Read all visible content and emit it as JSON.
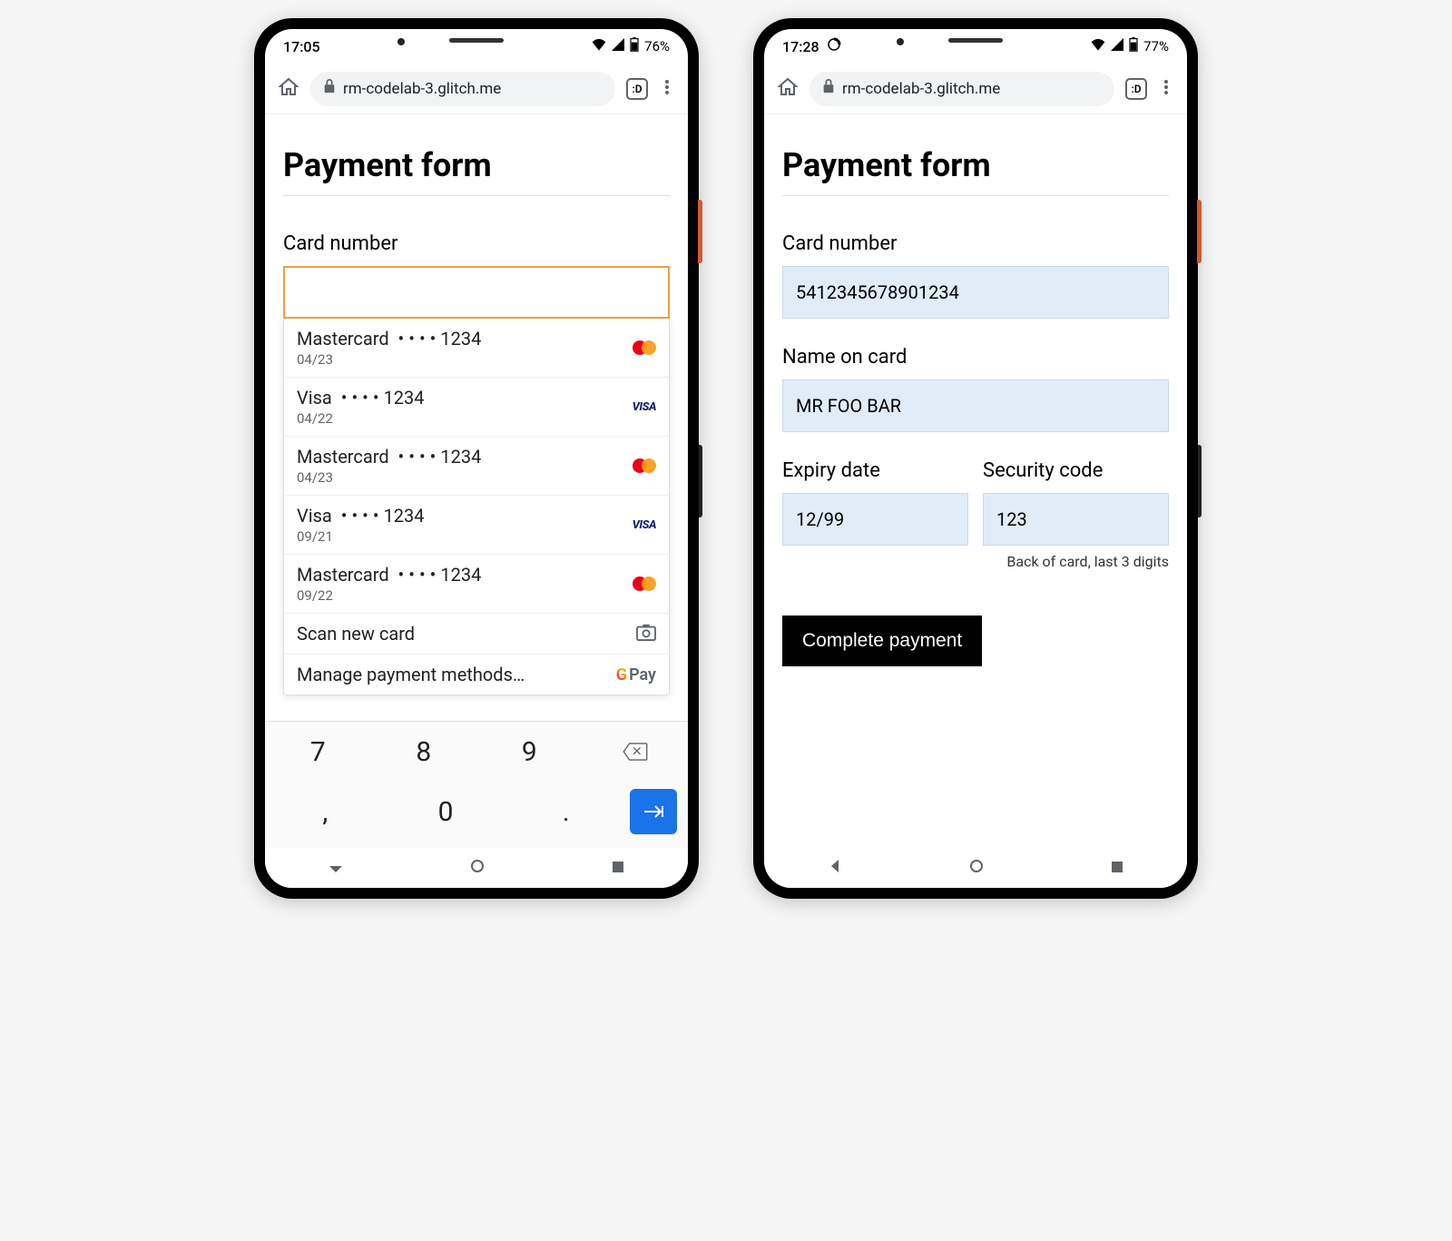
{
  "phone1": {
    "status": {
      "time": "17:05",
      "battery": "76%"
    },
    "browser": {
      "url": "rm-codelab-3.glitch.me",
      "tabs": ":D"
    },
    "page": {
      "title": "Payment form",
      "card_number_label": "Card number",
      "autofill": {
        "cards": [
          {
            "brand": "Mastercard",
            "masked": "• • • • 1234",
            "exp": "04/23",
            "type": "mc"
          },
          {
            "brand": "Visa",
            "masked": "• • • • 1234",
            "exp": "04/22",
            "type": "visa"
          },
          {
            "brand": "Mastercard",
            "masked": "• • • • 1234",
            "exp": "04/23",
            "type": "mc"
          },
          {
            "brand": "Visa",
            "masked": "• • • • 1234",
            "exp": "09/21",
            "type": "visa"
          },
          {
            "brand": "Mastercard",
            "masked": "• • • • 1234",
            "exp": "09/22",
            "type": "mc"
          }
        ],
        "scan": "Scan new card",
        "manage": "Manage payment methods…"
      },
      "keyboard": [
        "7",
        "8",
        "9",
        "⌫",
        ",",
        "0",
        ".",
        "→|"
      ]
    }
  },
  "phone2": {
    "status": {
      "time": "17:28",
      "battery": "77%"
    },
    "browser": {
      "url": "rm-codelab-3.glitch.me",
      "tabs": ":D"
    },
    "page": {
      "title": "Payment form",
      "card_number_label": "Card number",
      "card_number_value": "5412345678901234",
      "name_label": "Name on card",
      "name_value": "MR FOO BAR",
      "expiry_label": "Expiry date",
      "expiry_value": "12/99",
      "cvc_label": "Security code",
      "cvc_value": "123",
      "cvc_hint": "Back of card, last 3 digits",
      "submit": "Complete payment"
    }
  }
}
